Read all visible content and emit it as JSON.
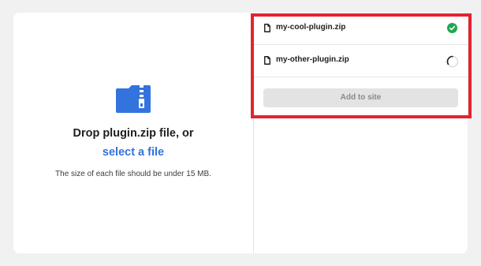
{
  "dropzone": {
    "icon": "zip-folder-icon",
    "title": "Drop plugin.zip file, or",
    "link": "select a file",
    "note": "The size of each file should be under 15 MB."
  },
  "files": [
    {
      "name": "my-cool-plugin.zip",
      "icon": "file-icon",
      "status": "complete",
      "status_icon": "check-circle-icon"
    },
    {
      "name": "my-other-plugin.zip",
      "icon": "file-icon",
      "status": "uploading",
      "status_icon": "spinner-icon"
    }
  ],
  "actions": {
    "add_label": "Add to site"
  },
  "colors": {
    "accent": "#3373dd",
    "success": "#1fa84f",
    "highlight": "#e3232f"
  }
}
